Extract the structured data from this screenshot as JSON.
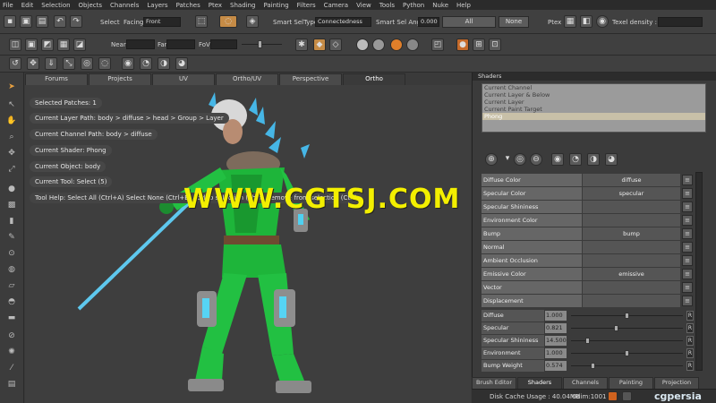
{
  "menu": [
    "File",
    "Edit",
    "Selection",
    "Objects",
    "Channels",
    "Layers",
    "Patches",
    "Ptex",
    "Shading",
    "Painting",
    "Filters",
    "Camera",
    "View",
    "Tools",
    "Python",
    "Nuke",
    "Help"
  ],
  "toolbar1": {
    "select_label": "Select",
    "facing_label": "Facing",
    "facing_value": "Front",
    "smart_seltype_label": "Smart SelType:",
    "smart_seltype_value": "Connectedness",
    "smart_sel_angle_label": "Smart Sel Angle",
    "smart_sel_angle_value": "0.000",
    "all_label": "All",
    "none_label": "None",
    "ptex_label": "Ptex",
    "texel_density_label": "Texel density :"
  },
  "toolbar2": {
    "near_label": "Near",
    "far_label": "Far",
    "fov_label": "FoV"
  },
  "tabs": [
    "Forums",
    "Projects",
    "UV",
    "Ortho/UV",
    "Perspective",
    "Ortho"
  ],
  "active_tab": "Ortho",
  "info": {
    "selected_patches": "Selected Patches: 1",
    "layer_path": "Current Layer Path: body > diffuse > head > Group > Layer",
    "channel_path": "Current Channel Path: body > diffuse",
    "shader": "Current Shader: Phong",
    "object": "Current Object: body",
    "tool": "Current Tool: Select (5)",
    "tool_help": "Tool Help: Select All (Ctrl+A)  Select None (Ctrl+E)  Add to selection (Shift)  Remove from selection (Ctrl)"
  },
  "watermark": "WWW.CGTSJ.COM",
  "shaders": {
    "title": "Shaders",
    "list": [
      "Current Channel",
      "Current Layer & Below",
      "Current Layer",
      "Current Paint Target",
      "Phong"
    ],
    "selected": "Phong",
    "channels": [
      {
        "name": "Diffuse Color",
        "value": "diffuse"
      },
      {
        "name": "Specular Color",
        "value": "specular"
      },
      {
        "name": "Specular Shininess",
        "value": ""
      },
      {
        "name": "Environment Color",
        "value": ""
      },
      {
        "name": "Bump",
        "value": "bump"
      },
      {
        "name": "Normal",
        "value": ""
      },
      {
        "name": "Ambient Occlusion",
        "value": ""
      },
      {
        "name": "Emissive Color",
        "value": "emissive"
      },
      {
        "name": "Vector",
        "value": ""
      },
      {
        "name": "Displacement",
        "value": ""
      }
    ],
    "params": [
      {
        "name": "Diffuse",
        "value": "1.000",
        "level": 0.5
      },
      {
        "name": "Specular",
        "value": "0.821",
        "level": 0.41
      },
      {
        "name": "Specular Shininess",
        "value": "14.500",
        "level": 0.15
      },
      {
        "name": "Environment",
        "value": "1.000",
        "level": 0.5
      },
      {
        "name": "Bump Weight",
        "value": "0.574",
        "level": 0.2
      }
    ],
    "bottom_tabs": [
      "Brush Editor",
      "Shaders",
      "Channels",
      "Painting",
      "Projection"
    ],
    "active_bottom_tab": "Shaders"
  },
  "status": {
    "disk_cache": "Disk Cache Usage : 40.04MB",
    "udim": "Udim:1001",
    "brand": "cgpersia"
  }
}
